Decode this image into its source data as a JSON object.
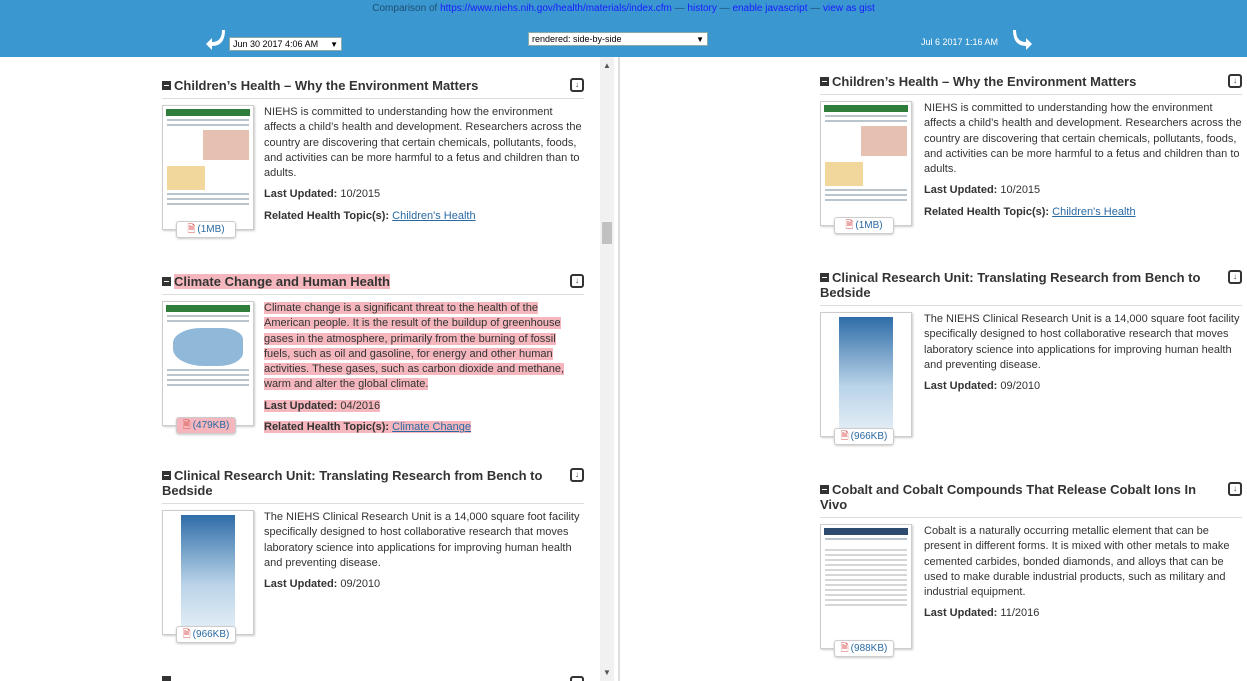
{
  "topbar": {
    "prefix": "Comparison of ",
    "url": "https://www.niehs.nih.gov/health/materials/index.cfm",
    "sep1": " — ",
    "history": "history",
    "sep2": " — ",
    "enable_js": "enable javascript",
    "sep3": " — ",
    "gist": "view as gist",
    "left_timestamp": "Jun 30 2017 4:06 AM",
    "render_mode": "rendered: side-by-side",
    "right_timestamp": "Jul 6 2017 1:16 AM",
    "colors": {
      "bar": "#3a97cf",
      "removed": "#f5b7bd"
    },
    "icons": {
      "left": "curved-arrow-left-icon",
      "right": "curved-arrow-right-icon"
    }
  },
  "left": {
    "entries": [
      {
        "title": "Children’s Health – Why the Environment Matters",
        "size": "(1MB)",
        "desc": "NIEHS is committed to understanding how the environment affects a child’s health and development. Researchers across the country are discovering that certain chemicals, pollutants, foods, and activities can be more harmful to a fetus and children than to adults.",
        "updated_label": "Last Updated:",
        "updated": "10/2015",
        "topic_label": "Related Health Topic(s):",
        "topic": "Children's Health"
      },
      {
        "title": "Climate Change and Human Health",
        "size": "(479KB)",
        "desc": "Climate change is a significant threat to the health of the American people. It is the result of the buildup of greenhouse gases in the atmosphere, primarily from the burning of fossil fuels, such as oil and gasoline, for energy and other human activities. These gases, such as carbon dioxide and methane, warm and alter the global climate.",
        "updated_label": "Last Updated:",
        "updated": "04/2016",
        "topic_label": "Related Health Topic(s):",
        "topic": "Climate Change"
      },
      {
        "title": "Clinical Research Unit: Translating Research from Bench to Bedside",
        "size": "(966KB)",
        "desc": "The NIEHS Clinical Research Unit is a 14,000 square foot facility specifically designed to host collaborative research that moves laboratory science into applications for improving human health and preventing disease.",
        "updated_label": "Last Updated:",
        "updated": "09/2010"
      }
    ]
  },
  "right": {
    "entries": [
      {
        "title": "Children’s Health – Why the Environment Matters",
        "size": "(1MB)",
        "desc": "NIEHS is committed to understanding how the environment affects a child’s health and development. Researchers across the country are discovering that certain chemicals, pollutants, foods, and activities can be more harmful to a fetus and children than to adults.",
        "updated_label": "Last Updated:",
        "updated": "10/2015",
        "topic_label": "Related Health Topic(s):",
        "topic": "Children's Health"
      },
      {
        "title": "Clinical Research Unit: Translating Research from Bench to Bedside",
        "size": "(966KB)",
        "desc": "The NIEHS Clinical Research Unit is a 14,000 square foot facility specifically designed to host collaborative research that moves laboratory science into applications for improving human health and preventing disease.",
        "updated_label": "Last Updated:",
        "updated": "09/2010"
      },
      {
        "title": "Cobalt and Cobalt Compounds That Release Cobalt Ions In Vivo",
        "size": "(988KB)",
        "desc": "Cobalt is a naturally occurring metallic element that can be present in different forms. It is mixed with other metals to make cemented carbides, bonded diamonds, and alloys that can be used to make durable industrial products, such as military and industrial equipment.",
        "updated_label": "Last Updated:",
        "updated": "11/2016"
      }
    ]
  }
}
